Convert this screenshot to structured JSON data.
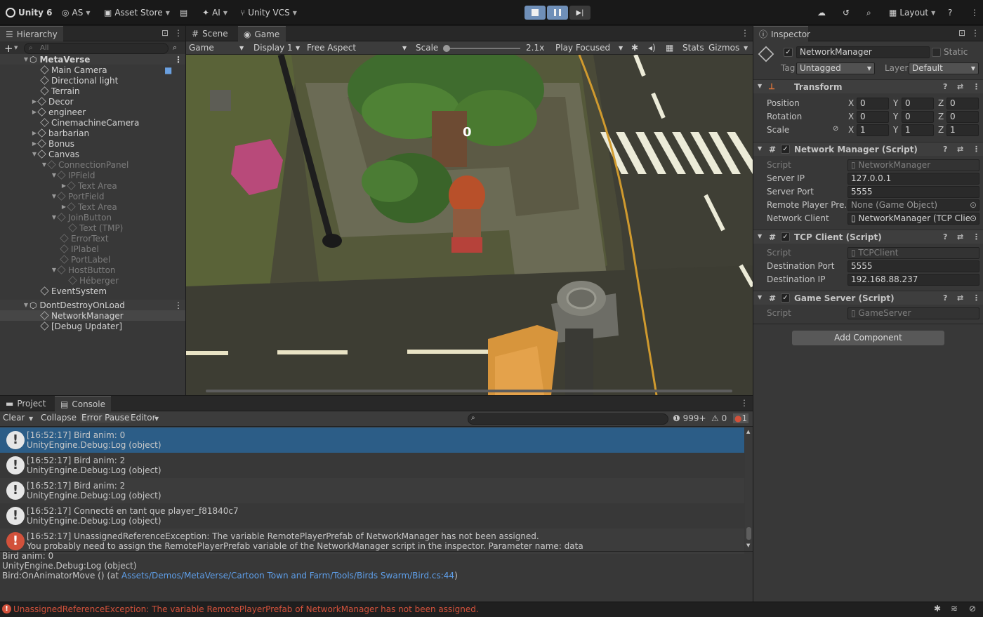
{
  "toolbar": {
    "app": "Unity 6",
    "account": "AS",
    "asset_store": "Asset Store",
    "ai": "AI",
    "vcs": "Unity VCS",
    "layout": "Layout"
  },
  "hierarchy": {
    "tab": "Hierarchy",
    "search_placeholder": "All",
    "items": [
      {
        "label": "MetaVerse"
      },
      {
        "label": "Main Camera"
      },
      {
        "label": "Directional light"
      },
      {
        "label": "Terrain"
      },
      {
        "label": "Decor"
      },
      {
        "label": "engineer"
      },
      {
        "label": "CinemachineCamera"
      },
      {
        "label": "barbarian"
      },
      {
        "label": "Bonus"
      },
      {
        "label": "Canvas"
      },
      {
        "label": "ConnectionPanel"
      },
      {
        "label": "IPField"
      },
      {
        "label": "Text Area"
      },
      {
        "label": "PortField"
      },
      {
        "label": "Text Area"
      },
      {
        "label": "JoinButton"
      },
      {
        "label": "Text (TMP)"
      },
      {
        "label": "ErrorText"
      },
      {
        "label": "IPlabel"
      },
      {
        "label": "PortLabel"
      },
      {
        "label": "HostButton"
      },
      {
        "label": "Héberger"
      },
      {
        "label": "EventSystem"
      },
      {
        "label": "DontDestroyOnLoad"
      },
      {
        "label": "NetworkManager"
      },
      {
        "label": "[Debug Updater]"
      }
    ]
  },
  "scene_tabs": {
    "scene": "Scene",
    "game": "Game"
  },
  "game_toolbar": {
    "mode": "Game",
    "display": "Display 1",
    "aspect": "Free Aspect",
    "scale_label": "Scale",
    "scale_value": "2.1x",
    "play_focused": "Play Focused",
    "stats": "Stats",
    "gizmos": "Gizmos"
  },
  "game_hud": {
    "score": "0"
  },
  "inspector": {
    "tab": "Inspector",
    "object_name": "NetworkManager",
    "static_label": "Static",
    "tag_label": "Tag",
    "tag_value": "Untagged",
    "layer_label": "Layer",
    "layer_value": "Default",
    "transform": {
      "title": "Transform",
      "position_label": "Position",
      "rotation_label": "Rotation",
      "scale_label": "Scale",
      "position": [
        "0",
        "0",
        "0"
      ],
      "rotation": [
        "0",
        "0",
        "0"
      ],
      "scale": [
        "1",
        "1",
        "1"
      ],
      "axis": [
        "X",
        "Y",
        "Z"
      ]
    },
    "network_manager": {
      "title": "Network Manager (Script)",
      "script_label": "Script",
      "script_value": "NetworkManager",
      "server_ip_label": "Server IP",
      "server_ip": "127.0.0.1",
      "server_port_label": "Server Port",
      "server_port": "5555",
      "remote_prefab_label": "Remote Player Pre...",
      "remote_prefab_value": "None (Game Object)",
      "network_client_label": "Network Client",
      "network_client_value": "NetworkManager (TCP Clien"
    },
    "tcp_client": {
      "title": "TCP Client (Script)",
      "script_label": "Script",
      "script_value": "TCPClient",
      "dest_port_label": "Destination Port",
      "dest_port": "5555",
      "dest_ip_label": "Destination IP",
      "dest_ip": "192.168.88.237"
    },
    "game_server": {
      "title": "Game Server (Script)",
      "script_label": "Script",
      "script_value": "GameServer"
    },
    "add_component": "Add Component"
  },
  "console": {
    "tabs": {
      "project": "Project",
      "console": "Console"
    },
    "clear": "Clear",
    "collapse": "Collapse",
    "error_pause": "Error Pause",
    "editor": "Editor",
    "count_log": "999+",
    "count_warn": "0",
    "count_err": "1",
    "messages": [
      {
        "line1": "[16:52:17] Bird anim: 0",
        "line2": "UnityEngine.Debug:Log (object)"
      },
      {
        "line1": "[16:52:17] Bird anim: 2",
        "line2": "UnityEngine.Debug:Log (object)"
      },
      {
        "line1": "[16:52:17] Bird anim: 2",
        "line2": "UnityEngine.Debug:Log (object)"
      },
      {
        "line1": "[16:52:17] Connecté en tant que player_f81840c7",
        "line2": "UnityEngine.Debug:Log (object)"
      },
      {
        "line1": "[16:52:17] UnassignedReferenceException: The variable RemotePlayerPrefab of NetworkManager has not been assigned.",
        "line2": "You probably need to assign the RemotePlayerPrefab variable of the NetworkManager script in the inspector. Parameter name: data"
      }
    ],
    "detail": {
      "line1": "Bird anim: 0",
      "line2": "UnityEngine.Debug:Log (object)",
      "line3_prefix": "Bird:OnAnimatorMove () (at ",
      "line3_link": "Assets/Demos/MetaVerse/Cartoon Town and Farm/Tools/Birds Swarm/Bird.cs:44",
      "line3_suffix": ")"
    }
  },
  "status_bar": {
    "message": "UnassignedReferenceException: The variable RemotePlayerPrefab of NetworkManager has not been assigned."
  },
  "colors": {
    "accent": "#2c5d87",
    "error": "#d2513b",
    "link": "#5e9ee8"
  }
}
